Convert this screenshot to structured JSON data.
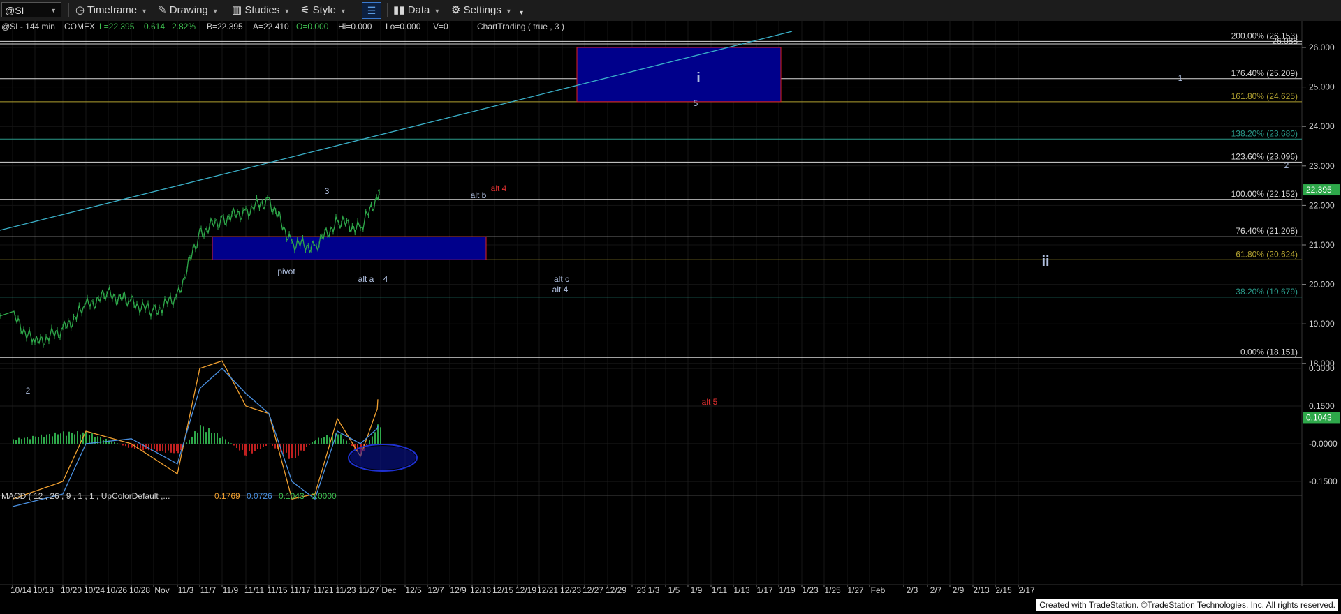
{
  "toolbar": {
    "symbol": "@SI",
    "timeframe": "Timeframe",
    "drawing": "Drawing",
    "studies": "Studies",
    "style": "Style",
    "data": "Data",
    "settings": "Settings"
  },
  "status": {
    "symbol_info": "@SI - 144 min",
    "exchange": "COMEX",
    "last": "L=22.395",
    "change": "0.614",
    "change_pct": "2.82%",
    "bid": "B=22.395",
    "ask": "A=22.410",
    "open": "O=0.000",
    "hi": "Hi=0.000",
    "lo": "Lo=0.000",
    "vol": "V=0",
    "chart_trading": "ChartTrading ( true , 3 )"
  },
  "macd": {
    "label": "MACD ( 12 , 26 , 9 , 1 , 1 , UpColorDefault ,...",
    "v1": "0.1769",
    "v2": "0.0726",
    "v3": "0.1043",
    "v4": "0.0000",
    "y_ticks": [
      "0.3000",
      "0.1500",
      "-0.0000",
      "-0.1500"
    ],
    "current": "0.1043"
  },
  "colors": {
    "fib_white": "#d8d8d8",
    "fib_olive": "#b0a030",
    "fib_teal": "#2a9a8a",
    "trendline": "#3ab0c8",
    "box_fill": "#00008b",
    "box_border": "#e02020",
    "price": "#2ea84a",
    "macd_fast": "#f0a030",
    "macd_slow": "#4a90e0",
    "hist_up": "#2ea84a",
    "hist_down": "#c02020",
    "wave_red": "#e03030",
    "wave_label": "#b0c0e0"
  },
  "footer": "Created with TradeStation. ©TradeStation Technologies, Inc. All rights reserved.",
  "chart_data": [
    {
      "type": "line",
      "title": "",
      "xlabel": "",
      "ylabel": "",
      "ylim": [
        17.4,
        26.8
      ],
      "grid": true,
      "x_ticks": [
        "10/14",
        "10/18",
        "10/20",
        "10/24",
        "10/26",
        "10/28",
        "Nov",
        "11/3",
        "11/7",
        "11/9",
        "11/11",
        "11/15",
        "11/17",
        "11/21",
        "11/23",
        "11/27",
        "Dec",
        "12/5",
        "12/7",
        "12/9",
        "12/13",
        "12/15",
        "12/19",
        "12/21",
        "12/23",
        "12/27",
        "12/29",
        "'23",
        "1/3",
        "1/5",
        "1/9",
        "1/11",
        "1/13",
        "1/17",
        "1/19",
        "1/23",
        "1/25",
        "1/27",
        "Feb",
        "2/3",
        "2/7",
        "2/9",
        "2/13",
        "2/15",
        "2/17"
      ],
      "y_ticks": [
        "26.000",
        "25.000",
        "24.000",
        "23.000",
        "22.000",
        "21.000",
        "20.000",
        "19.000",
        "18.000"
      ],
      "current_price": "22.395",
      "series": [
        {
          "x": [
            "10/14",
            "10/18",
            "10/20",
            "10/24",
            "10/26",
            "10/28",
            "Nov",
            "11/3",
            "11/7",
            "11/9",
            "11/11",
            "11/15",
            "11/17",
            "11/21",
            "11/23",
            "11/27",
            "Dec"
          ],
          "values": [
            19.2,
            18.5,
            18.85,
            19.45,
            19.75,
            19.55,
            19.3,
            19.7,
            21.3,
            21.65,
            21.85,
            22.15,
            21.05,
            20.95,
            21.6,
            21.4,
            22.395
          ]
        }
      ],
      "fib_levels": [
        {
          "label": "200.00% (26.153)",
          "value": 26.153,
          "color": "white"
        },
        {
          "label": "26.088",
          "value": 26.088,
          "color": "white"
        },
        {
          "label": "176.40% (25.209)",
          "value": 25.209,
          "color": "white"
        },
        {
          "label": "161.80% (24.625)",
          "value": 24.625,
          "color": "olive"
        },
        {
          "label": "138.20% (23.680)",
          "value": 23.68,
          "color": "teal"
        },
        {
          "label": "123.60% (23.096)",
          "value": 23.096,
          "color": "white"
        },
        {
          "label": "100.00% (22.152)",
          "value": 22.152,
          "color": "white"
        },
        {
          "label": "76.40% (21.208)",
          "value": 21.208,
          "color": "white"
        },
        {
          "label": "61.80% (20.624)",
          "value": 20.624,
          "color": "olive"
        },
        {
          "label": "38.20% (19.679)",
          "value": 19.679,
          "color": "teal"
        },
        {
          "label": "0.00% (18.151)",
          "value": 18.151,
          "color": "white"
        }
      ],
      "zones": [
        {
          "name": "target box",
          "x_from": "12/7",
          "x_to": "12/29",
          "y_from": 24.625,
          "y_to": 26.0
        },
        {
          "name": "pivot box",
          "x_from": "11/3",
          "x_to": "11/27",
          "y_from": 20.624,
          "y_to": 21.208
        }
      ],
      "trendline": {
        "from": {
          "x": "10/14",
          "y": 21.8
        },
        "to": {
          "x": "12/29",
          "y": 26.5
        }
      },
      "annotations": [
        {
          "text": "i",
          "x": "12/21",
          "y": 25.75,
          "color": "label"
        },
        {
          "text": "5",
          "x": "12/21",
          "y": 25.05,
          "color": "label"
        },
        {
          "text": "1",
          "x": "2/7",
          "y": 25.6,
          "color": "label"
        },
        {
          "text": "2",
          "x": "2/17",
          "y": 23.4,
          "color": "label"
        },
        {
          "text": "3",
          "x": "11/15",
          "y": 22.8,
          "color": "label"
        },
        {
          "text": "alt b",
          "x": "11/27",
          "y": 22.65,
          "color": "label"
        },
        {
          "text": "alt 4",
          "x": "Dec",
          "y": 22.85,
          "color": "red"
        },
        {
          "text": "pivot",
          "x": "11/9",
          "y": 20.75,
          "color": "label"
        },
        {
          "text": "alt a",
          "x": "11/17",
          "y": 20.5,
          "color": "label"
        },
        {
          "text": "4",
          "x": "11/21",
          "y": 20.5,
          "color": "label"
        },
        {
          "text": "alt c",
          "x": "12/7",
          "y": 20.5,
          "color": "label"
        },
        {
          "text": "alt 4",
          "x": "12/7",
          "y": 20.2,
          "color": "label"
        },
        {
          "text": "ii",
          "x": "1/23",
          "y": 20.95,
          "color": "label"
        },
        {
          "text": "2",
          "x": "10/14",
          "y": 17.7,
          "color": "label"
        },
        {
          "text": "alt 5",
          "x": "12/21",
          "y": 17.4,
          "color": "red"
        }
      ]
    },
    {
      "type": "line",
      "title": "",
      "ylim": [
        -0.28,
        0.36
      ],
      "series": [
        {
          "name": "MACD",
          "x": [
            "10/14",
            "10/20",
            "10/24",
            "10/28",
            "11/3",
            "11/7",
            "11/9",
            "11/11",
            "11/15",
            "11/17",
            "11/21",
            "11/23",
            "11/27",
            "Dec"
          ],
          "values": [
            -0.22,
            -0.15,
            0.05,
            0.0,
            -0.12,
            0.3,
            0.33,
            0.15,
            0.12,
            -0.22,
            -0.2,
            0.1,
            -0.05,
            0.1769
          ]
        },
        {
          "name": "Signal",
          "x": [
            "10/14",
            "10/20",
            "10/24",
            "10/28",
            "11/3",
            "11/7",
            "11/9",
            "11/11",
            "11/15",
            "11/17",
            "11/21",
            "11/23",
            "11/27",
            "Dec"
          ],
          "values": [
            -0.25,
            -0.2,
            0.0,
            0.02,
            -0.08,
            0.22,
            0.3,
            0.2,
            0.12,
            -0.15,
            -0.22,
            0.05,
            0.0,
            0.0726
          ]
        },
        {
          "name": "Histogram",
          "x": [
            "10/14",
            "10/20",
            "10/24",
            "10/28",
            "11/3",
            "11/7",
            "11/9",
            "11/11",
            "11/15",
            "11/17",
            "11/21",
            "11/23",
            "11/27",
            "Dec"
          ],
          "values": [
            0.02,
            0.05,
            0.05,
            -0.02,
            -0.04,
            0.08,
            0.03,
            -0.05,
            0.0,
            -0.07,
            0.02,
            0.05,
            -0.05,
            0.1043
          ]
        }
      ]
    }
  ]
}
